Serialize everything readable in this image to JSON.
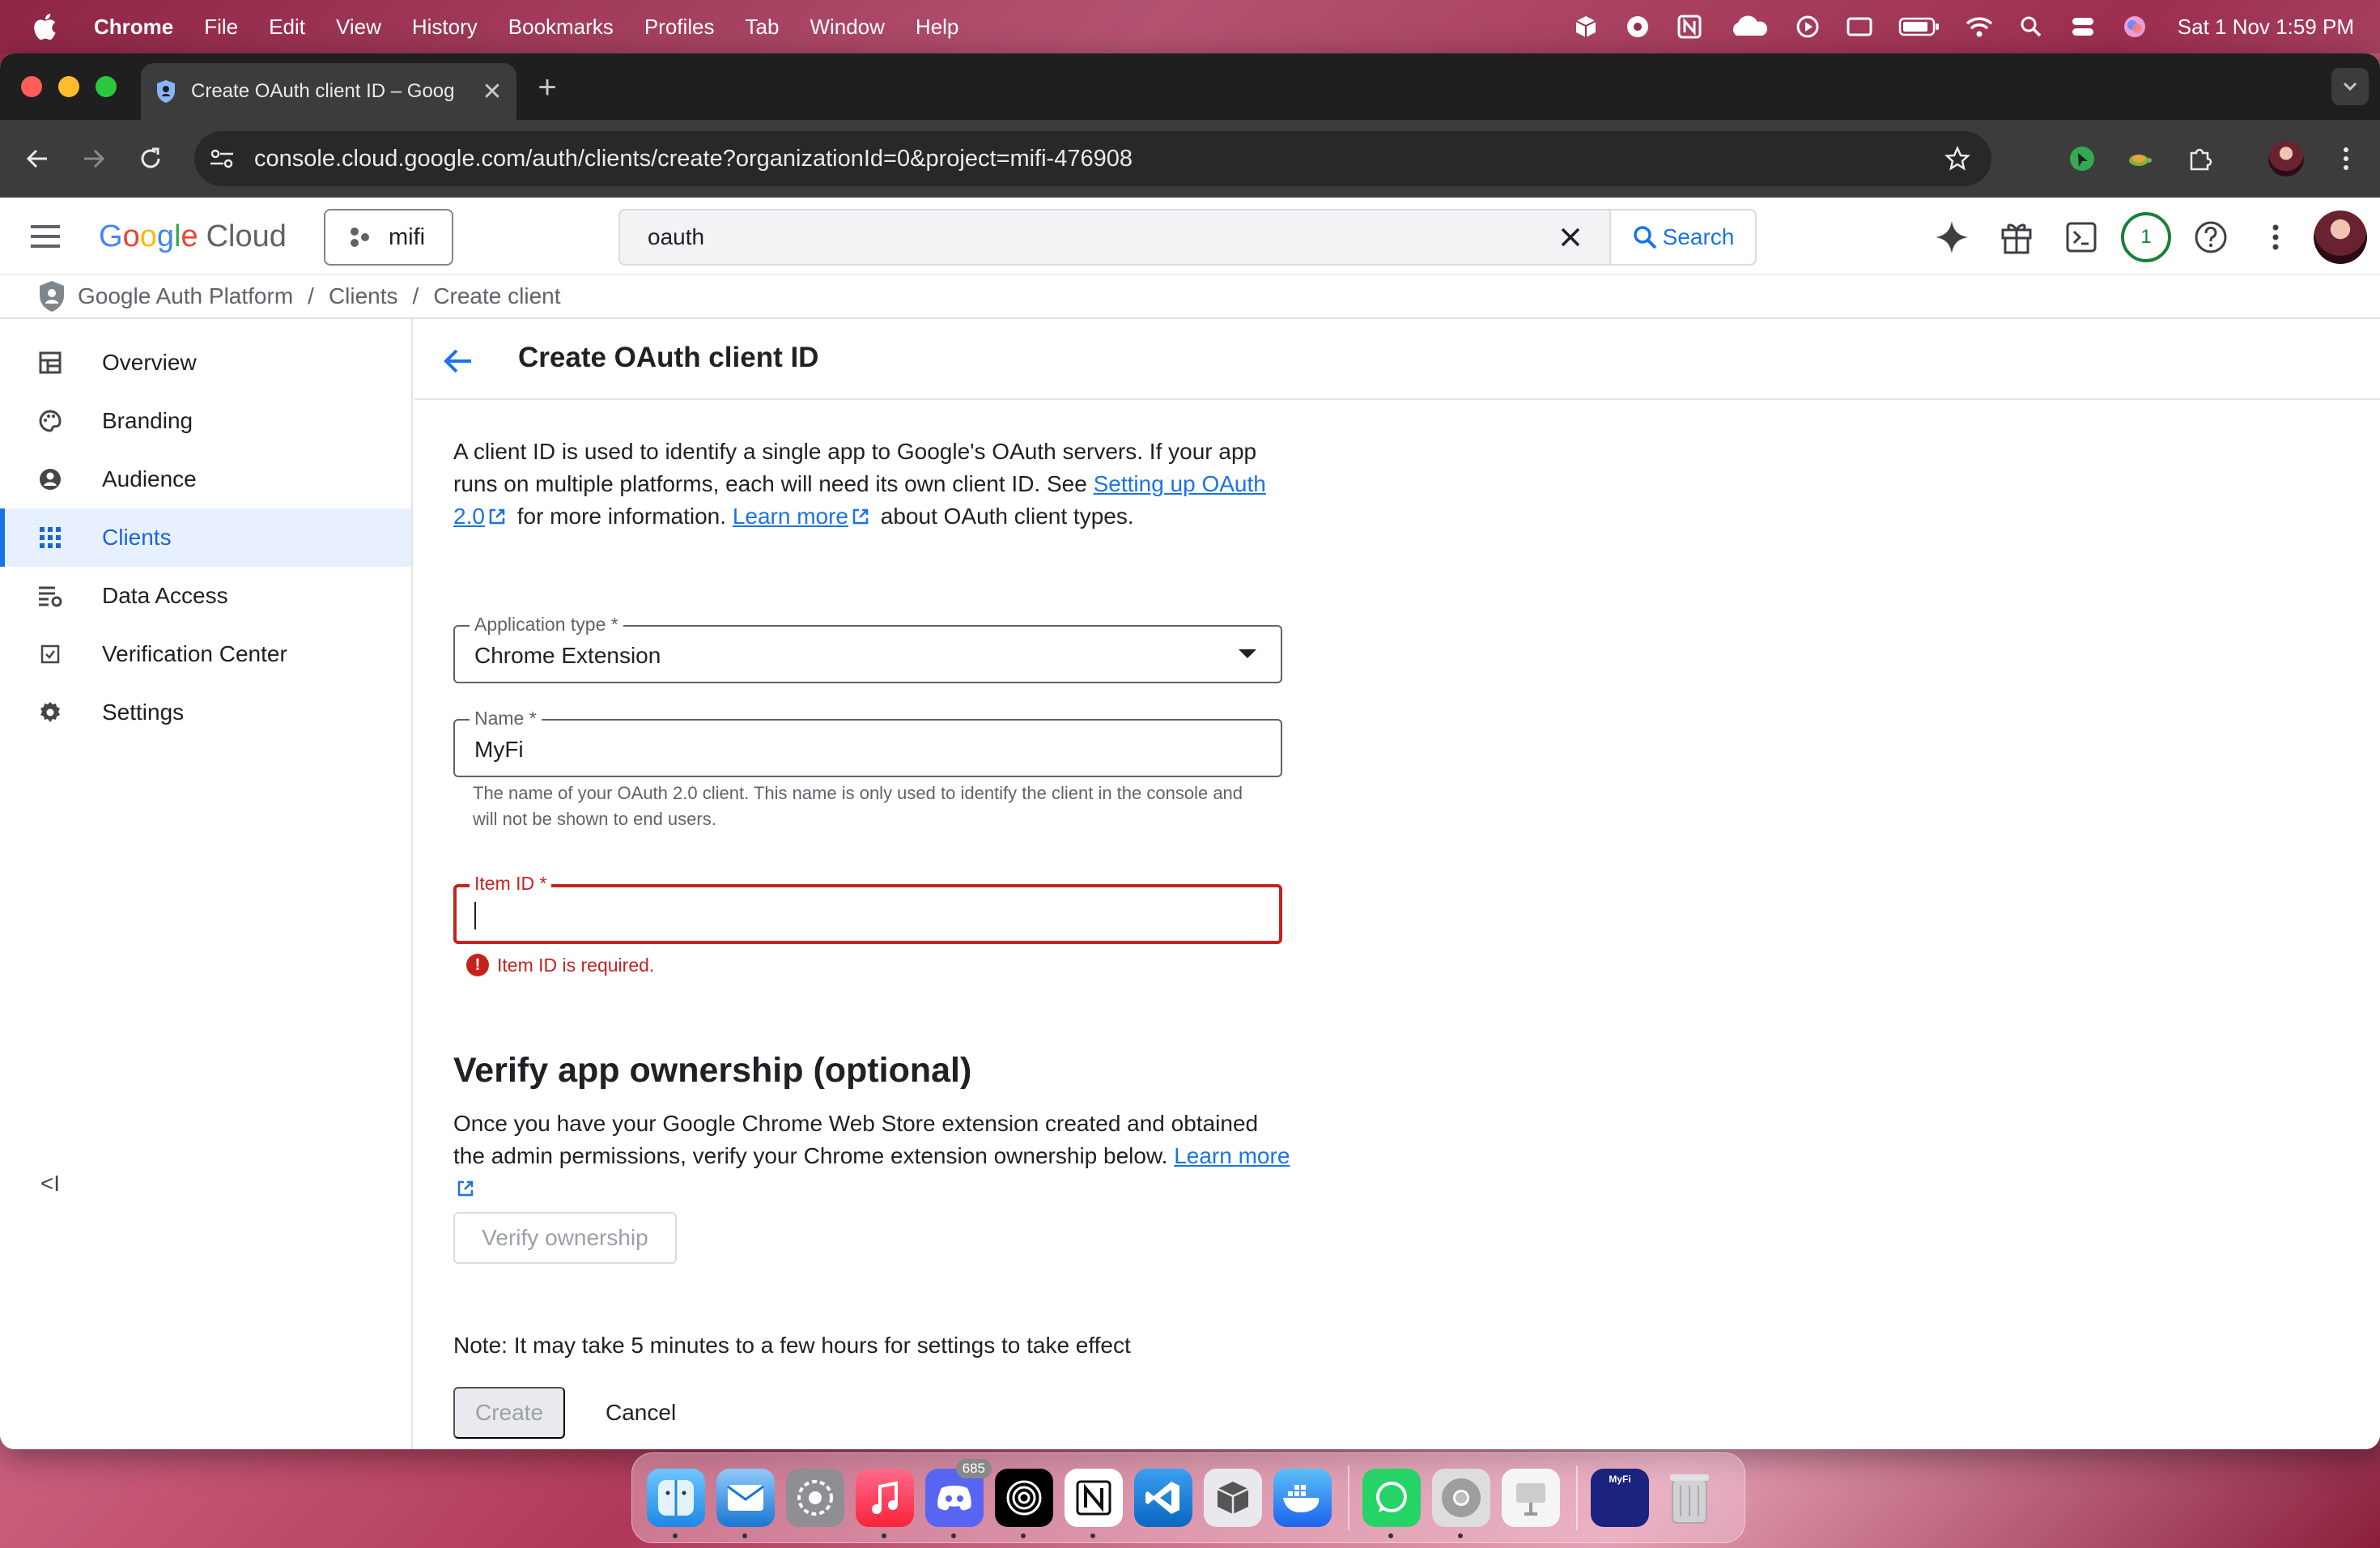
{
  "menubar": {
    "app_name": "Chrome",
    "menus": [
      "File",
      "Edit",
      "View",
      "History",
      "Bookmarks",
      "Profiles",
      "Tab",
      "Window",
      "Help"
    ],
    "clock": "Sat 1 Nov  1:59 PM"
  },
  "browser": {
    "tab_title": "Create OAuth client ID – Goog",
    "url": "console.cloud.google.com/auth/clients/create?organizationId=0&project=mifi-476908"
  },
  "cloud_header": {
    "logo_word": "Cloud",
    "project_name": "mifi",
    "search_value": "oauth",
    "search_button": "Search",
    "notifications_count": "1"
  },
  "breadcrumb": {
    "items": [
      "Google Auth Platform",
      "Clients",
      "Create client"
    ],
    "separator": "/"
  },
  "sidenav": {
    "items": [
      {
        "label": "Overview",
        "icon": "dashboard-icon"
      },
      {
        "label": "Branding",
        "icon": "palette-icon"
      },
      {
        "label": "Audience",
        "icon": "person-icon"
      },
      {
        "label": "Clients",
        "icon": "apps-grid-icon",
        "active": true
      },
      {
        "label": "Data Access",
        "icon": "data-settings-icon"
      },
      {
        "label": "Verification Center",
        "icon": "checkbox-icon"
      },
      {
        "label": "Settings",
        "icon": "gear-icon"
      }
    ],
    "collapse_label": "<I"
  },
  "page": {
    "title": "Create OAuth client ID",
    "intro_1": "A client ID is used to identify a single app to Google's OAuth servers. If your app runs on multiple platforms, each will need its own client ID. See ",
    "intro_link_1": "Setting up OAuth 2.0",
    "intro_2": " for more information. ",
    "intro_link_2": "Learn more",
    "intro_3": " about OAuth client types.",
    "app_type": {
      "label": "Application type *",
      "value": "Chrome Extension"
    },
    "name": {
      "label": "Name *",
      "value": "MyFi",
      "hint": "The name of your OAuth 2.0 client. This name is only used to identify the client in the console and will not be shown to end users."
    },
    "item_id": {
      "label": "Item ID *",
      "value": "",
      "error": "Item ID is required."
    },
    "verify": {
      "title": "Verify app ownership (optional)",
      "text": "Once you have your Google Chrome Web Store extension created and obtained the admin permissions, verify your Chrome extension ownership below. ",
      "link": "Learn more",
      "button": "Verify ownership"
    },
    "note": "Note: It may take 5 minutes to a few hours for settings to take effect",
    "create_button": "Create",
    "cancel_button": "Cancel"
  },
  "dock": {
    "discord_badge": "685",
    "store_tile_text": "MyFi"
  },
  "colors": {
    "primary": "#1a73e8",
    "error": "#c5221f",
    "active_nav_bg": "#e8f0fe"
  }
}
